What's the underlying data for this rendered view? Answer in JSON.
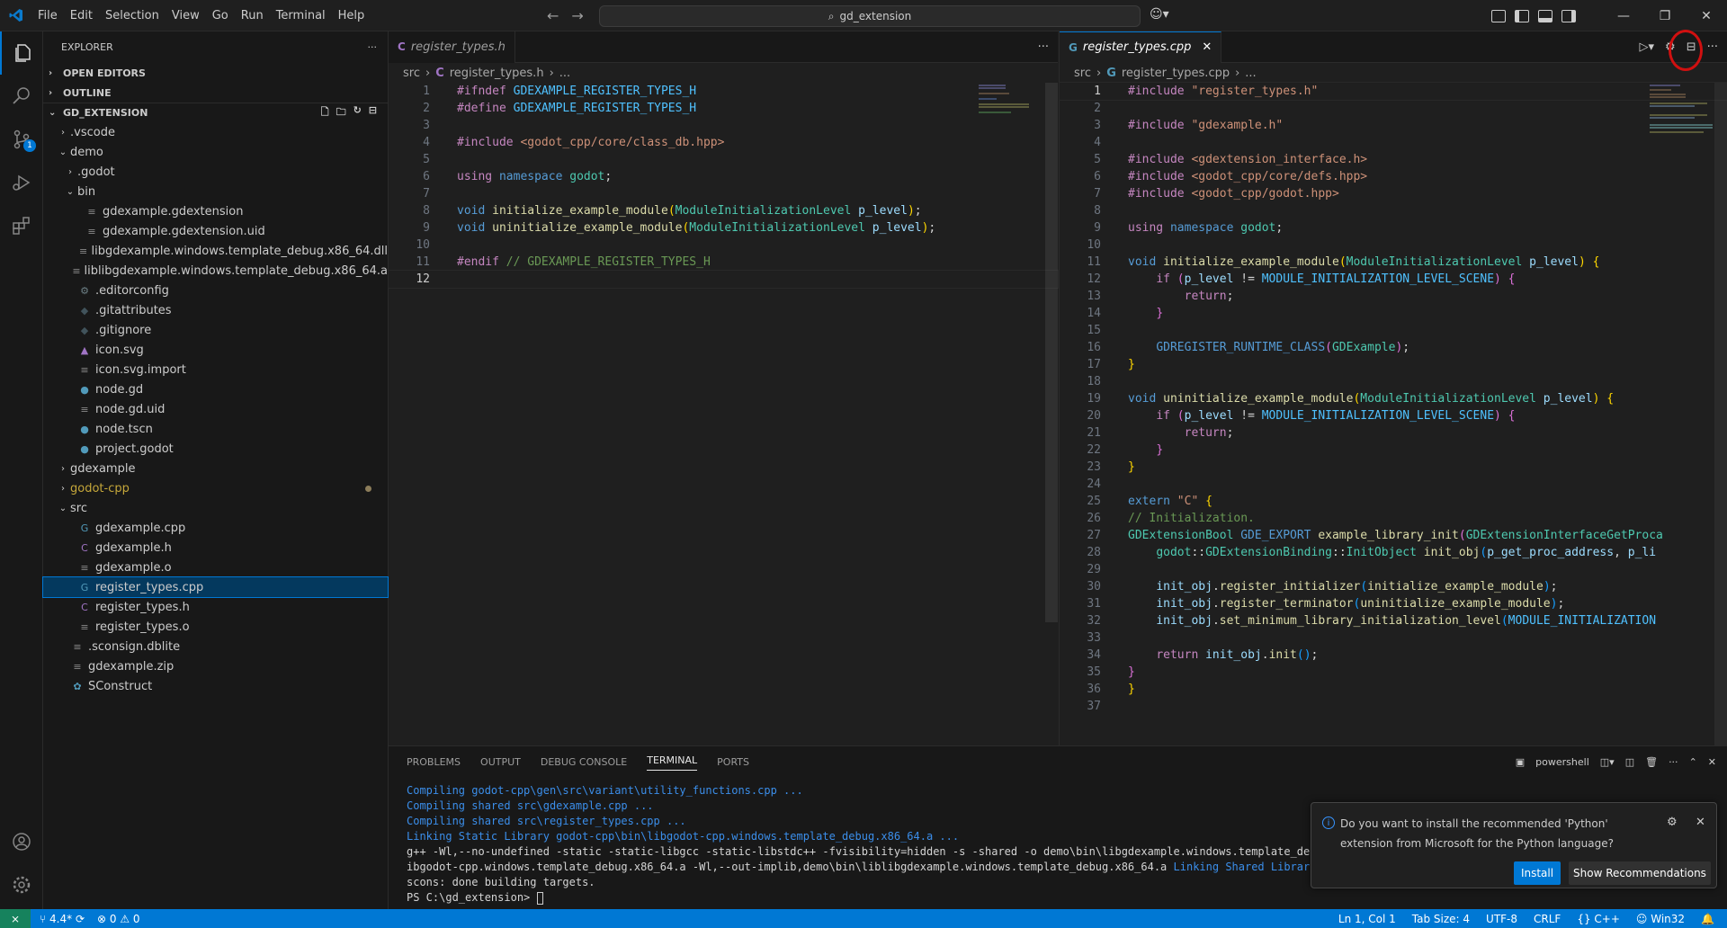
{
  "menu": [
    "File",
    "Edit",
    "Selection",
    "View",
    "Go",
    "Run",
    "Terminal",
    "Help"
  ],
  "search": {
    "text": "gd_extension"
  },
  "explorer": {
    "title": "EXPLORER",
    "open_editors": "OPEN EDITORS",
    "outline": "OUTLINE",
    "project": "GD_EXTENSION",
    "tree": [
      {
        "depth": 1,
        "twisty": "›",
        "icon": "",
        "label": ".vscode"
      },
      {
        "depth": 1,
        "twisty": "⌄",
        "icon": "",
        "label": "demo"
      },
      {
        "depth": 2,
        "twisty": "›",
        "icon": "",
        "label": ".godot"
      },
      {
        "depth": 2,
        "twisty": "⌄",
        "icon": "",
        "label": "bin"
      },
      {
        "depth": 3,
        "twisty": "",
        "icon": "≡",
        "label": "gdexample.gdextension"
      },
      {
        "depth": 3,
        "twisty": "",
        "icon": "≡",
        "label": "gdexample.gdextension.uid"
      },
      {
        "depth": 3,
        "twisty": "",
        "icon": "≡",
        "label": "libgdexample.windows.template_debug.x86_64.dll"
      },
      {
        "depth": 3,
        "twisty": "",
        "icon": "≡",
        "label": "liblibgdexample.windows.template_debug.x86_64.a"
      },
      {
        "depth": 2,
        "twisty": "",
        "icon": "⚙",
        "label": ".editorconfig"
      },
      {
        "depth": 2,
        "twisty": "",
        "icon": "◆",
        "label": ".gitattributes"
      },
      {
        "depth": 2,
        "twisty": "",
        "icon": "◆",
        "label": ".gitignore"
      },
      {
        "depth": 2,
        "twisty": "",
        "icon": "▲",
        "label": "icon.svg"
      },
      {
        "depth": 2,
        "twisty": "",
        "icon": "≡",
        "label": "icon.svg.import"
      },
      {
        "depth": 2,
        "twisty": "",
        "icon": "●",
        "label": "node.gd"
      },
      {
        "depth": 2,
        "twisty": "",
        "icon": "≡",
        "label": "node.gd.uid"
      },
      {
        "depth": 2,
        "twisty": "",
        "icon": "●",
        "label": "node.tscn"
      },
      {
        "depth": 2,
        "twisty": "",
        "icon": "●",
        "label": "project.godot"
      },
      {
        "depth": 1,
        "twisty": "›",
        "icon": "",
        "label": "gdexample"
      },
      {
        "depth": 1,
        "twisty": "›",
        "icon": "",
        "label": "godot-cpp",
        "modified": true
      },
      {
        "depth": 1,
        "twisty": "⌄",
        "icon": "",
        "label": "src"
      },
      {
        "depth": 2,
        "twisty": "",
        "icon": "G",
        "label": "gdexample.cpp"
      },
      {
        "depth": 2,
        "twisty": "",
        "icon": "C",
        "label": "gdexample.h"
      },
      {
        "depth": 2,
        "twisty": "",
        "icon": "≡",
        "label": "gdexample.o"
      },
      {
        "depth": 2,
        "twisty": "",
        "icon": "G",
        "label": "register_types.cpp",
        "selected": true
      },
      {
        "depth": 2,
        "twisty": "",
        "icon": "C",
        "label": "register_types.h"
      },
      {
        "depth": 2,
        "twisty": "",
        "icon": "≡",
        "label": "register_types.o"
      },
      {
        "depth": 1,
        "twisty": "",
        "icon": "≡",
        "label": ".sconsign.dblite"
      },
      {
        "depth": 1,
        "twisty": "",
        "icon": "≡",
        "label": "gdexample.zip"
      },
      {
        "depth": 1,
        "twisty": "",
        "icon": "✿",
        "label": "SConstruct"
      }
    ]
  },
  "editor_left": {
    "tab": "register_types.h",
    "crumbs": [
      "src",
      "register_types.h",
      "..."
    ],
    "lines": [
      [
        [
          "c",
          "#ifndef "
        ],
        [
          "m",
          "GDEXAMPLE_REGISTER_TYPES_H"
        ]
      ],
      [
        [
          "c",
          "#define "
        ],
        [
          "m",
          "GDEXAMPLE_REGISTER_TYPES_H"
        ]
      ],
      [],
      [
        [
          "c",
          "#include "
        ],
        [
          "s",
          "<godot_cpp/core/class_db.hpp>"
        ]
      ],
      [],
      [
        [
          "c",
          "using "
        ],
        [
          "k",
          "namespace "
        ],
        [
          "t",
          "godot"
        ],
        [
          "w",
          ";"
        ]
      ],
      [],
      [
        [
          "k",
          "void "
        ],
        [
          "f",
          "initialize_example_module"
        ],
        [
          "b1",
          "("
        ],
        [
          "t",
          "ModuleInitializationLevel "
        ],
        [
          "v",
          "p_level"
        ],
        [
          "b1",
          ")"
        ],
        [
          "w",
          ";"
        ]
      ],
      [
        [
          "k",
          "void "
        ],
        [
          "f",
          "uninitialize_example_module"
        ],
        [
          "b1",
          "("
        ],
        [
          "t",
          "ModuleInitializationLevel "
        ],
        [
          "v",
          "p_level"
        ],
        [
          "b1",
          ")"
        ],
        [
          "w",
          ";"
        ]
      ],
      [],
      [
        [
          "c",
          "#endif "
        ],
        [
          "cm",
          "// GDEXAMPLE_REGISTER_TYPES_H"
        ]
      ],
      []
    ],
    "current_line": 12
  },
  "editor_right": {
    "tab": "register_types.cpp",
    "crumbs": [
      "src",
      "register_types.cpp",
      "..."
    ],
    "lines": [
      [
        [
          "c",
          "#include "
        ],
        [
          "s",
          "\"register_types.h\""
        ]
      ],
      [],
      [
        [
          "c",
          "#include "
        ],
        [
          "s",
          "\"gdexample.h\""
        ]
      ],
      [],
      [
        [
          "c",
          "#include "
        ],
        [
          "s",
          "<gdextension_interface.h>"
        ]
      ],
      [
        [
          "c",
          "#include "
        ],
        [
          "s",
          "<godot_cpp/core/defs.hpp>"
        ]
      ],
      [
        [
          "c",
          "#include "
        ],
        [
          "s",
          "<godot_cpp/godot.hpp>"
        ]
      ],
      [],
      [
        [
          "c",
          "using "
        ],
        [
          "k",
          "namespace "
        ],
        [
          "t",
          "godot"
        ],
        [
          "w",
          ";"
        ]
      ],
      [],
      [
        [
          "k",
          "void "
        ],
        [
          "f",
          "initialize_example_module"
        ],
        [
          "b1",
          "("
        ],
        [
          "t",
          "ModuleInitializationLevel "
        ],
        [
          "v",
          "p_level"
        ],
        [
          "b1",
          ") {"
        ]
      ],
      [
        [
          "w",
          "    "
        ],
        [
          "c",
          "if "
        ],
        [
          "b2",
          "("
        ],
        [
          "v",
          "p_level"
        ],
        [
          "w",
          " != "
        ],
        [
          "m",
          "MODULE_INITIALIZATION_LEVEL_SCENE"
        ],
        [
          "b2",
          ") {"
        ]
      ],
      [
        [
          "w",
          "        "
        ],
        [
          "c",
          "return"
        ],
        [
          "w",
          ";"
        ]
      ],
      [
        [
          "w",
          "    "
        ],
        [
          "b2",
          "}"
        ]
      ],
      [],
      [
        [
          "w",
          "    "
        ],
        [
          "k",
          "GDREGISTER_RUNTIME_CLASS"
        ],
        [
          "b2",
          "("
        ],
        [
          "t",
          "GDExample"
        ],
        [
          "b2",
          ")"
        ],
        [
          "w",
          ";"
        ]
      ],
      [
        [
          "b1",
          "}"
        ]
      ],
      [],
      [
        [
          "k",
          "void "
        ],
        [
          "f",
          "uninitialize_example_module"
        ],
        [
          "b1",
          "("
        ],
        [
          "t",
          "ModuleInitializationLevel "
        ],
        [
          "v",
          "p_level"
        ],
        [
          "b1",
          ") {"
        ]
      ],
      [
        [
          "w",
          "    "
        ],
        [
          "c",
          "if "
        ],
        [
          "b2",
          "("
        ],
        [
          "v",
          "p_level"
        ],
        [
          "w",
          " != "
        ],
        [
          "m",
          "MODULE_INITIALIZATION_LEVEL_SCENE"
        ],
        [
          "b2",
          ") {"
        ]
      ],
      [
        [
          "w",
          "        "
        ],
        [
          "c",
          "return"
        ],
        [
          "w",
          ";"
        ]
      ],
      [
        [
          "w",
          "    "
        ],
        [
          "b2",
          "}"
        ]
      ],
      [
        [
          "b1",
          "}"
        ]
      ],
      [],
      [
        [
          "k",
          "extern "
        ],
        [
          "s",
          "\"C\" "
        ],
        [
          "b1",
          "{"
        ]
      ],
      [
        [
          "cm",
          "// Initialization."
        ]
      ],
      [
        [
          "t",
          "GDExtensionBool "
        ],
        [
          "k",
          "GDE_EXPORT "
        ],
        [
          "f",
          "example_library_init"
        ],
        [
          "b2",
          "("
        ],
        [
          "t",
          "GDExtensionInterfaceGetProca"
        ]
      ],
      [
        [
          "w",
          "    "
        ],
        [
          "t",
          "godot"
        ],
        [
          "w",
          "::"
        ],
        [
          "t",
          "GDExtensionBinding"
        ],
        [
          "w",
          "::"
        ],
        [
          "t",
          "InitObject "
        ],
        [
          "f",
          "init_obj"
        ],
        [
          "b3",
          "("
        ],
        [
          "v",
          "p_get_proc_address"
        ],
        [
          "w",
          ", "
        ],
        [
          "v",
          "p_li"
        ]
      ],
      [],
      [
        [
          "w",
          "    "
        ],
        [
          "v",
          "init_obj"
        ],
        [
          "w",
          "."
        ],
        [
          "f",
          "register_initializer"
        ],
        [
          "b3",
          "("
        ],
        [
          "f",
          "initialize_example_module"
        ],
        [
          "b3",
          ")"
        ],
        [
          "w",
          ";"
        ]
      ],
      [
        [
          "w",
          "    "
        ],
        [
          "v",
          "init_obj"
        ],
        [
          "w",
          "."
        ],
        [
          "f",
          "register_terminator"
        ],
        [
          "b3",
          "("
        ],
        [
          "f",
          "uninitialize_example_module"
        ],
        [
          "b3",
          ")"
        ],
        [
          "w",
          ";"
        ]
      ],
      [
        [
          "w",
          "    "
        ],
        [
          "v",
          "init_obj"
        ],
        [
          "w",
          "."
        ],
        [
          "f",
          "set_minimum_library_initialization_level"
        ],
        [
          "b3",
          "("
        ],
        [
          "m",
          "MODULE_INITIALIZATION"
        ]
      ],
      [],
      [
        [
          "w",
          "    "
        ],
        [
          "c",
          "return "
        ],
        [
          "v",
          "init_obj"
        ],
        [
          "w",
          "."
        ],
        [
          "f",
          "init"
        ],
        [
          "b3",
          "()"
        ],
        [
          "w",
          ";"
        ]
      ],
      [
        [
          "b2",
          "}"
        ]
      ],
      [
        [
          "b1",
          "}"
        ]
      ],
      []
    ],
    "current_line": 1
  },
  "panel": {
    "tabs": [
      "PROBLEMS",
      "OUTPUT",
      "DEBUG CONSOLE",
      "TERMINAL",
      "PORTS"
    ],
    "active_tab": "TERMINAL",
    "shell": "powershell",
    "terminal": [
      [
        [
          "tb",
          "Compiling godot-cpp\\gen\\src\\variant\\utility_functions.cpp ..."
        ]
      ],
      [
        [
          "tb",
          "Compiling shared src\\gdexample.cpp ..."
        ]
      ],
      [
        [
          "tb",
          "Compiling shared src\\register_types.cpp ..."
        ]
      ],
      [
        [
          "tb",
          "Linking Static Library godot-cpp\\bin\\libgodot-cpp.windows.template_debug.x86_64.a ..."
        ]
      ],
      [
        [
          "w",
          "g++ -Wl,--no-undefined -static -static-libgcc -static-libstdc++ -fvisibility=hidden -s -shared -o demo\\bin\\libgdexample.windows.template_debug.x"
        ]
      ],
      [
        [
          "w",
          "ibgodot-cpp.windows.template_debug.x86_64.a -Wl,--out-implib,demo\\bin\\liblibgdexample.windows.template_debug.x86_64.a "
        ],
        [
          "tb",
          "Linking Shared Library dem"
        ]
      ],
      [
        [
          "w",
          "scons: done building targets."
        ]
      ],
      [
        [
          "w",
          "PS C:\\gd_extension> "
        ]
      ]
    ]
  },
  "notification": {
    "message": "Do you want to install the recommended 'Python' extension from Microsoft for the Python language?",
    "install": "Install",
    "show": "Show Recommendations"
  },
  "status": {
    "branch": "4.4*",
    "problems": "⊗ 0 ⚠ 0",
    "position": "Ln 1, Col 1",
    "tab_size": "Tab Size: 4",
    "encoding": "UTF-8",
    "eol": "CRLF",
    "language": "{} C++",
    "platform": "Win32"
  }
}
